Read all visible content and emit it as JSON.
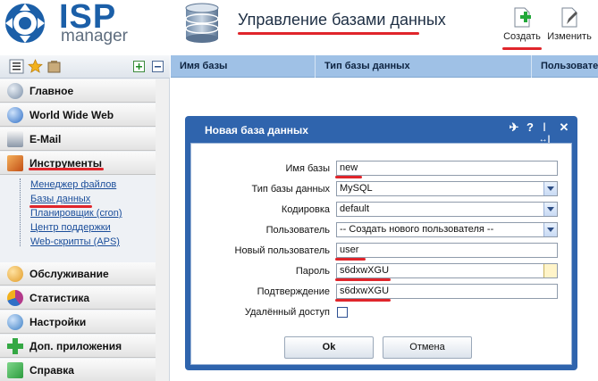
{
  "logo": {
    "isp": "ISP",
    "manager": "manager"
  },
  "header": {
    "title": "Управление базами данных"
  },
  "toolbar": {
    "create_label": "Создать",
    "edit_label": "Изменить"
  },
  "sidebar": {
    "groups": [
      {
        "label": "Главное",
        "color": "#7a8ea6"
      },
      {
        "label": "World Wide Web",
        "color": "#3a7bd5"
      },
      {
        "label": "E-Mail",
        "color": "#5a6b7e"
      },
      {
        "label": "Инструменты",
        "color": "#d06a24"
      },
      {
        "label": "Обслуживание",
        "color": "#e19b27"
      },
      {
        "label": "Статистика",
        "color": "#b33a8a"
      },
      {
        "label": "Настройки",
        "color": "#3c7fc5"
      },
      {
        "label": "Доп. приложения",
        "color": "#34a844"
      },
      {
        "label": "Справка",
        "color": "#2c9c3e"
      }
    ],
    "tools_items": [
      {
        "label": "Менеджер файлов"
      },
      {
        "label": "Базы данных"
      },
      {
        "label": "Планировщик (cron)"
      },
      {
        "label": "Центр поддержки"
      },
      {
        "label": "Web-скрипты (APS)"
      }
    ]
  },
  "table": {
    "columns": [
      "Имя базы",
      "Тип базы данных",
      "Пользовател"
    ]
  },
  "dialog": {
    "title": "Новая база данных",
    "fields": {
      "db_name": {
        "label": "Имя базы",
        "value": "new"
      },
      "db_type": {
        "label": "Тип базы данных",
        "value": "MySQL"
      },
      "encoding": {
        "label": "Кодировка",
        "value": "default"
      },
      "user": {
        "label": "Пользователь",
        "value": "-- Создать нового пользователя --"
      },
      "new_user": {
        "label": "Новый пользователь",
        "value": "user"
      },
      "password": {
        "label": "Пароль",
        "value": "s6dxwXGU"
      },
      "confirm": {
        "label": "Подтверждение",
        "value": "s6dxwXGU"
      },
      "remote": {
        "label": "Удалённый доступ",
        "checked": false
      }
    },
    "ok_label": "Ok",
    "cancel_label": "Отмена"
  },
  "colors": {
    "accent": "#2f64ad",
    "highlight": "#e0252b",
    "table_header": "#9fc1e6"
  }
}
